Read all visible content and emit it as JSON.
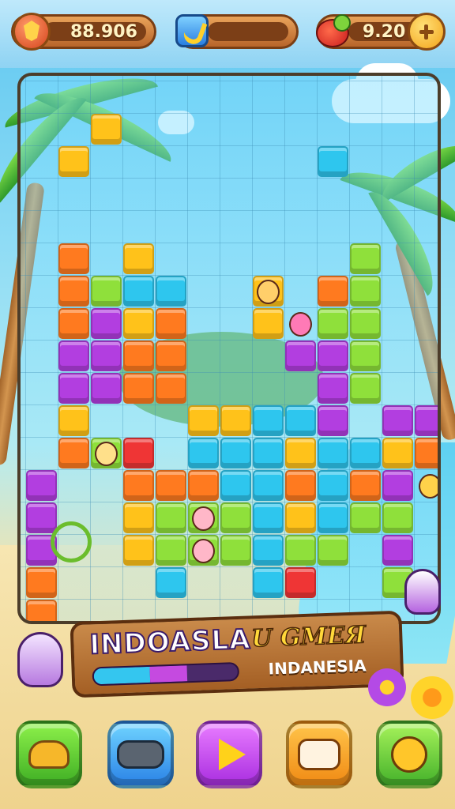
{
  "hud": {
    "score": "88.906",
    "lives": "9.20",
    "icons": [
      "gem-shield-icon",
      "banana-icon",
      "fruit-icon",
      "plus-icon"
    ]
  },
  "banner": {
    "title": "INDOASLA",
    "subtitle": "U GMEЯ",
    "region": "INDANESIA",
    "progress": 0.65
  },
  "buttons": [
    "animal-button",
    "gamepad-button",
    "play-button",
    "controller-button",
    "bird-button"
  ],
  "colors": {
    "orange": "#ff7a1f",
    "yellow": "#ffc21a",
    "lime": "#8fe03b",
    "purple": "#b23ee0",
    "cyan": "#2ec6ee",
    "red": "#ef3535",
    "board_border": "#4c3d2a"
  }
}
